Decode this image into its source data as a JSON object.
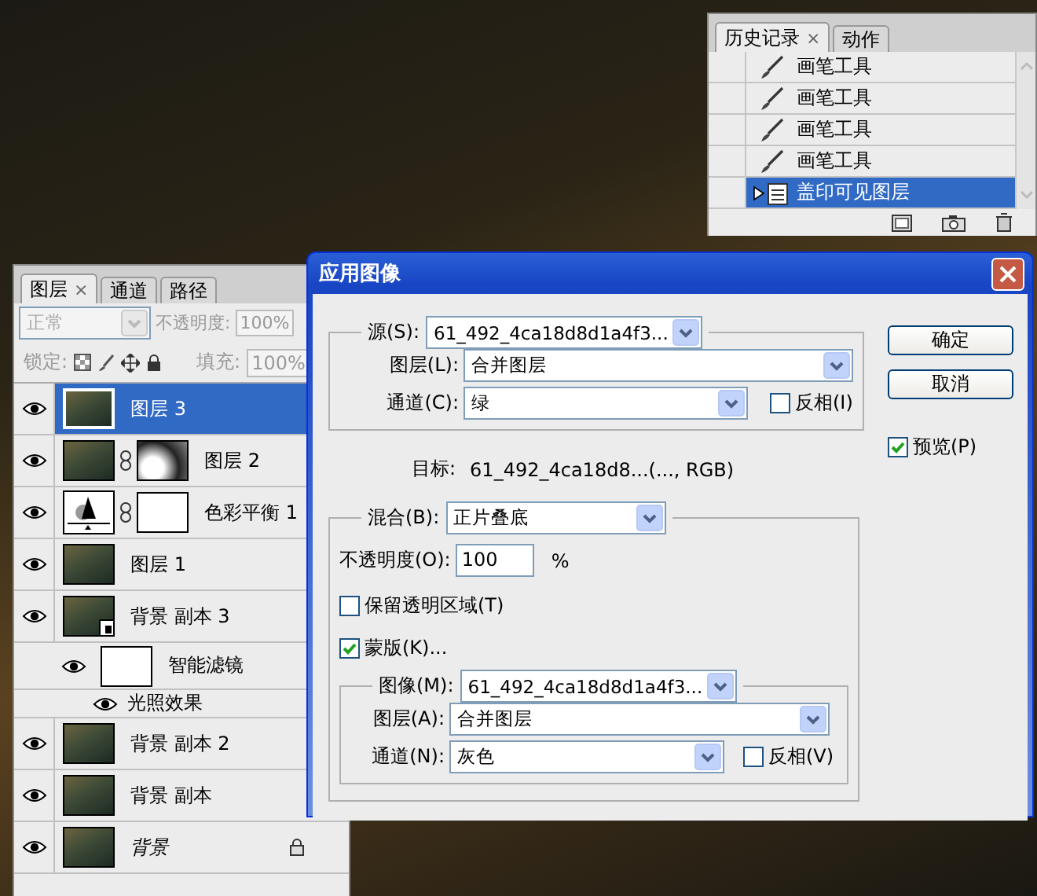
{
  "history_panel": {
    "tabs": [
      {
        "label": "历史记录",
        "selected": true,
        "close": "×"
      },
      {
        "label": "动作",
        "selected": false
      }
    ],
    "items": [
      {
        "label": "画笔工具",
        "kind": "brush",
        "selected": false
      },
      {
        "label": "画笔工具",
        "kind": "brush",
        "selected": false
      },
      {
        "label": "画笔工具",
        "kind": "brush",
        "selected": false
      },
      {
        "label": "画笔工具",
        "kind": "brush",
        "selected": false
      },
      {
        "label": "盖印可见图层",
        "kind": "stamp",
        "selected": true
      }
    ]
  },
  "layers_panel": {
    "tabs": [
      {
        "label": "图层",
        "selected": true,
        "close": "×"
      },
      {
        "label": "通道",
        "selected": false
      },
      {
        "label": "路径",
        "selected": false
      }
    ],
    "blend_mode": "正常",
    "controls_disabled": true,
    "opacity_label": "不透明度:",
    "opacity": "100%",
    "lock_label": "锁定:",
    "fill_label": "填充:",
    "fill": "100%",
    "layers": [
      {
        "name": "图层 3",
        "kind": "pixel",
        "visible": true,
        "selected": true,
        "locked": false
      },
      {
        "name": "图层 2",
        "kind": "pixel",
        "visible": true,
        "selected": false,
        "locked": false,
        "mask": {
          "kind": "painted"
        }
      },
      {
        "name": "色彩平衡 1",
        "kind": "adjustment",
        "visible": true,
        "selected": false,
        "locked": false,
        "mask": {
          "kind": "blank"
        }
      },
      {
        "name": "图层 1",
        "kind": "pixel",
        "visible": true,
        "selected": false,
        "locked": false
      },
      {
        "name": "背景 副本 3",
        "kind": "smart",
        "visible": true,
        "selected": false,
        "locked": false,
        "children": [
          {
            "name": "智能滤镜",
            "kind": "filter-mask",
            "visible": true,
            "selected": false,
            "children": [
              {
                "name": "光照效果",
                "kind": "filter",
                "visible": true,
                "selected": false
              }
            ]
          }
        ]
      },
      {
        "name": "背景 副本 2",
        "kind": "pixel",
        "visible": true,
        "selected": false,
        "locked": false
      },
      {
        "name": "背景 副本",
        "kind": "pixel",
        "visible": true,
        "selected": false,
        "locked": false
      },
      {
        "name": "背景",
        "kind": "background",
        "visible": true,
        "selected": false,
        "locked": true
      }
    ]
  },
  "dialog": {
    "title": "应用图像",
    "source": {
      "label": "源(S):",
      "value": "61_492_4ca18d8d1a4f3...",
      "layer_label": "图层(L):",
      "layer": "合并图层",
      "channel_label": "通道(C):",
      "channel": "绿",
      "invert_label": "反相(I)",
      "invert": false
    },
    "target_label": "目标:",
    "target": "61_492_4ca18d8...(..., RGB)",
    "blending_label": "混合(B):",
    "blending": "正片叠底",
    "opacity_label": "不透明度(O):",
    "opacity": "100",
    "percent": "%",
    "preserve_transparency": {
      "label": "保留透明区域(T)",
      "checked": false
    },
    "mask": {
      "label": "蒙版(K)...",
      "checked": true,
      "image_label": "图像(M):",
      "image": "61_492_4ca18d8d1a4f3...",
      "layer_label": "图层(A):",
      "layer": "合并图层",
      "channel_label": "通道(N):",
      "channel": "灰色",
      "invert_label": "反相(V)",
      "invert": false
    },
    "buttons": [
      "确定",
      "取消"
    ],
    "preview": {
      "label": "预览(P)",
      "checked": true
    }
  }
}
